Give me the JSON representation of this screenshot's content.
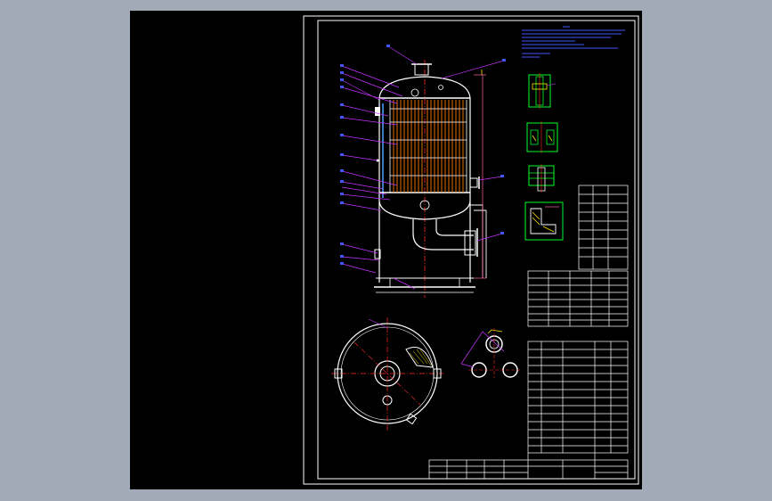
{
  "canvas": {
    "background": "#a2aab7",
    "viewport_background": "#000000",
    "colors": {
      "border": "#ffffff",
      "leader": "#c832ff",
      "center_line": "#ff2a2a",
      "tube": "#ff7a00",
      "nozzle": "#ffffff",
      "detail": "#00ff28",
      "text": "#4455ff",
      "hatch": "#ffe600",
      "pink": "#ff66aa"
    }
  },
  "drawing": {
    "views": [
      "front-elevation",
      "plan-section",
      "tube-layout",
      "detail-a",
      "detail-b",
      "detail-c",
      "detail-d"
    ],
    "tables": [
      "design-data-table",
      "nozzle-table",
      "parts-list",
      "title-block"
    ]
  }
}
